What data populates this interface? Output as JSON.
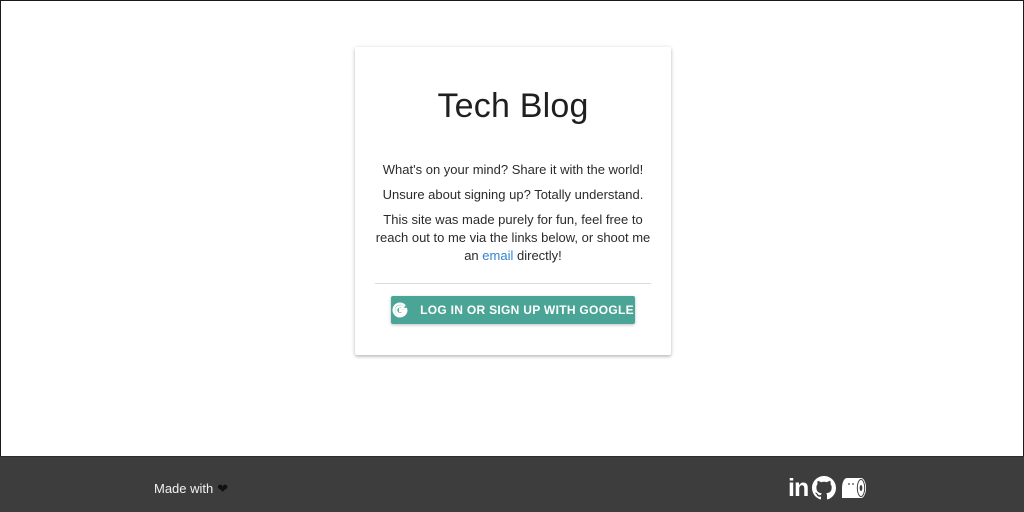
{
  "card": {
    "title": "Tech Blog",
    "line1": "What's on your mind? Share it with the world!",
    "line2": "Unsure about signing up? Totally understand.",
    "line3_before": "This site was made purely for fun, feel free to reach out to me via the links below, or shoot me an",
    "line3_link": "email",
    "line3_after": "directly!",
    "google_button_label": "LOG IN OR SIGN UP WITH GOOGLE"
  },
  "footer": {
    "made_with": "Made with",
    "heart": "❤",
    "social": {
      "linkedin_label": "in",
      "icons": [
        "linkedin-icon",
        "github-icon",
        "toilet-paper-icon"
      ]
    }
  },
  "colors": {
    "accent_button": "#4aa596",
    "link": "#2f83d1",
    "footer_bg": "#3d3d3d"
  }
}
